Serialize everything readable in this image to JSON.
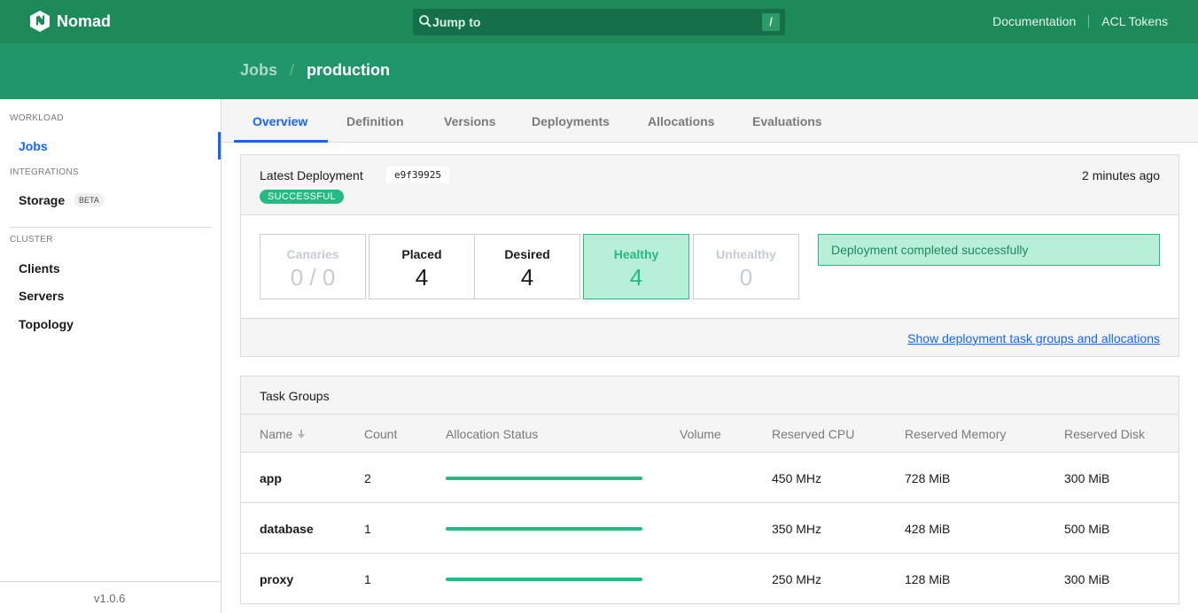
{
  "app": {
    "name": "Nomad"
  },
  "search": {
    "placeholder": "Jump to",
    "shortcut": "/"
  },
  "top_links": {
    "documentation": "Documentation",
    "acl_tokens": "ACL Tokens"
  },
  "breadcrumb": {
    "parent": "Jobs",
    "separator": "/",
    "current": "production"
  },
  "sidebar": {
    "workload_label": "WORKLOAD",
    "jobs": "Jobs",
    "integrations_label": "INTEGRATIONS",
    "storage": "Storage",
    "beta": "BETA",
    "cluster_label": "CLUSTER",
    "clients": "Clients",
    "servers": "Servers",
    "topology": "Topology",
    "version": "v1.0.6"
  },
  "tabs": {
    "overview": "Overview",
    "definition": "Definition",
    "versions": "Versions",
    "deployments": "Deployments",
    "allocations": "Allocations",
    "evaluations": "Evaluations",
    "active": "Overview"
  },
  "deployment": {
    "title": "Latest Deployment",
    "id": "e9f39925",
    "status": "SUCCESSFUL",
    "time": "2 minutes ago",
    "stats": {
      "canaries_label": "Canaries",
      "canaries_value": "0 / 0",
      "placed_label": "Placed",
      "placed_value": "4",
      "desired_label": "Desired",
      "desired_value": "4",
      "healthy_label": "Healthy",
      "healthy_value": "4",
      "unhealthy_label": "Unhealthy",
      "unhealthy_value": "0"
    },
    "notice": "Deployment completed successfully",
    "show_link": "Show deployment task groups and allocations"
  },
  "task_groups": {
    "title": "Task Groups",
    "columns": {
      "name": "Name",
      "count": "Count",
      "allocation_status": "Allocation Status",
      "volume": "Volume",
      "reserved_cpu": "Reserved CPU",
      "reserved_memory": "Reserved Memory",
      "reserved_disk": "Reserved Disk"
    },
    "rows": [
      {
        "name": "app",
        "count": "2",
        "allocation_running_fraction": 1.0,
        "volume": "",
        "cpu": "450 MHz",
        "memory": "728 MiB",
        "disk": "300 MiB"
      },
      {
        "name": "database",
        "count": "1",
        "allocation_running_fraction": 1.0,
        "volume": "",
        "cpu": "350 MHz",
        "memory": "428 MiB",
        "disk": "500 MiB"
      },
      {
        "name": "proxy",
        "count": "1",
        "allocation_running_fraction": 1.0,
        "volume": "",
        "cpu": "250 MHz",
        "memory": "128 MiB",
        "disk": "300 MiB"
      }
    ]
  },
  "colors": {
    "brand_green": "#1d8a5a",
    "header_green": "#21966a",
    "success_green": "#25ba81",
    "link_blue": "#1563ff"
  }
}
